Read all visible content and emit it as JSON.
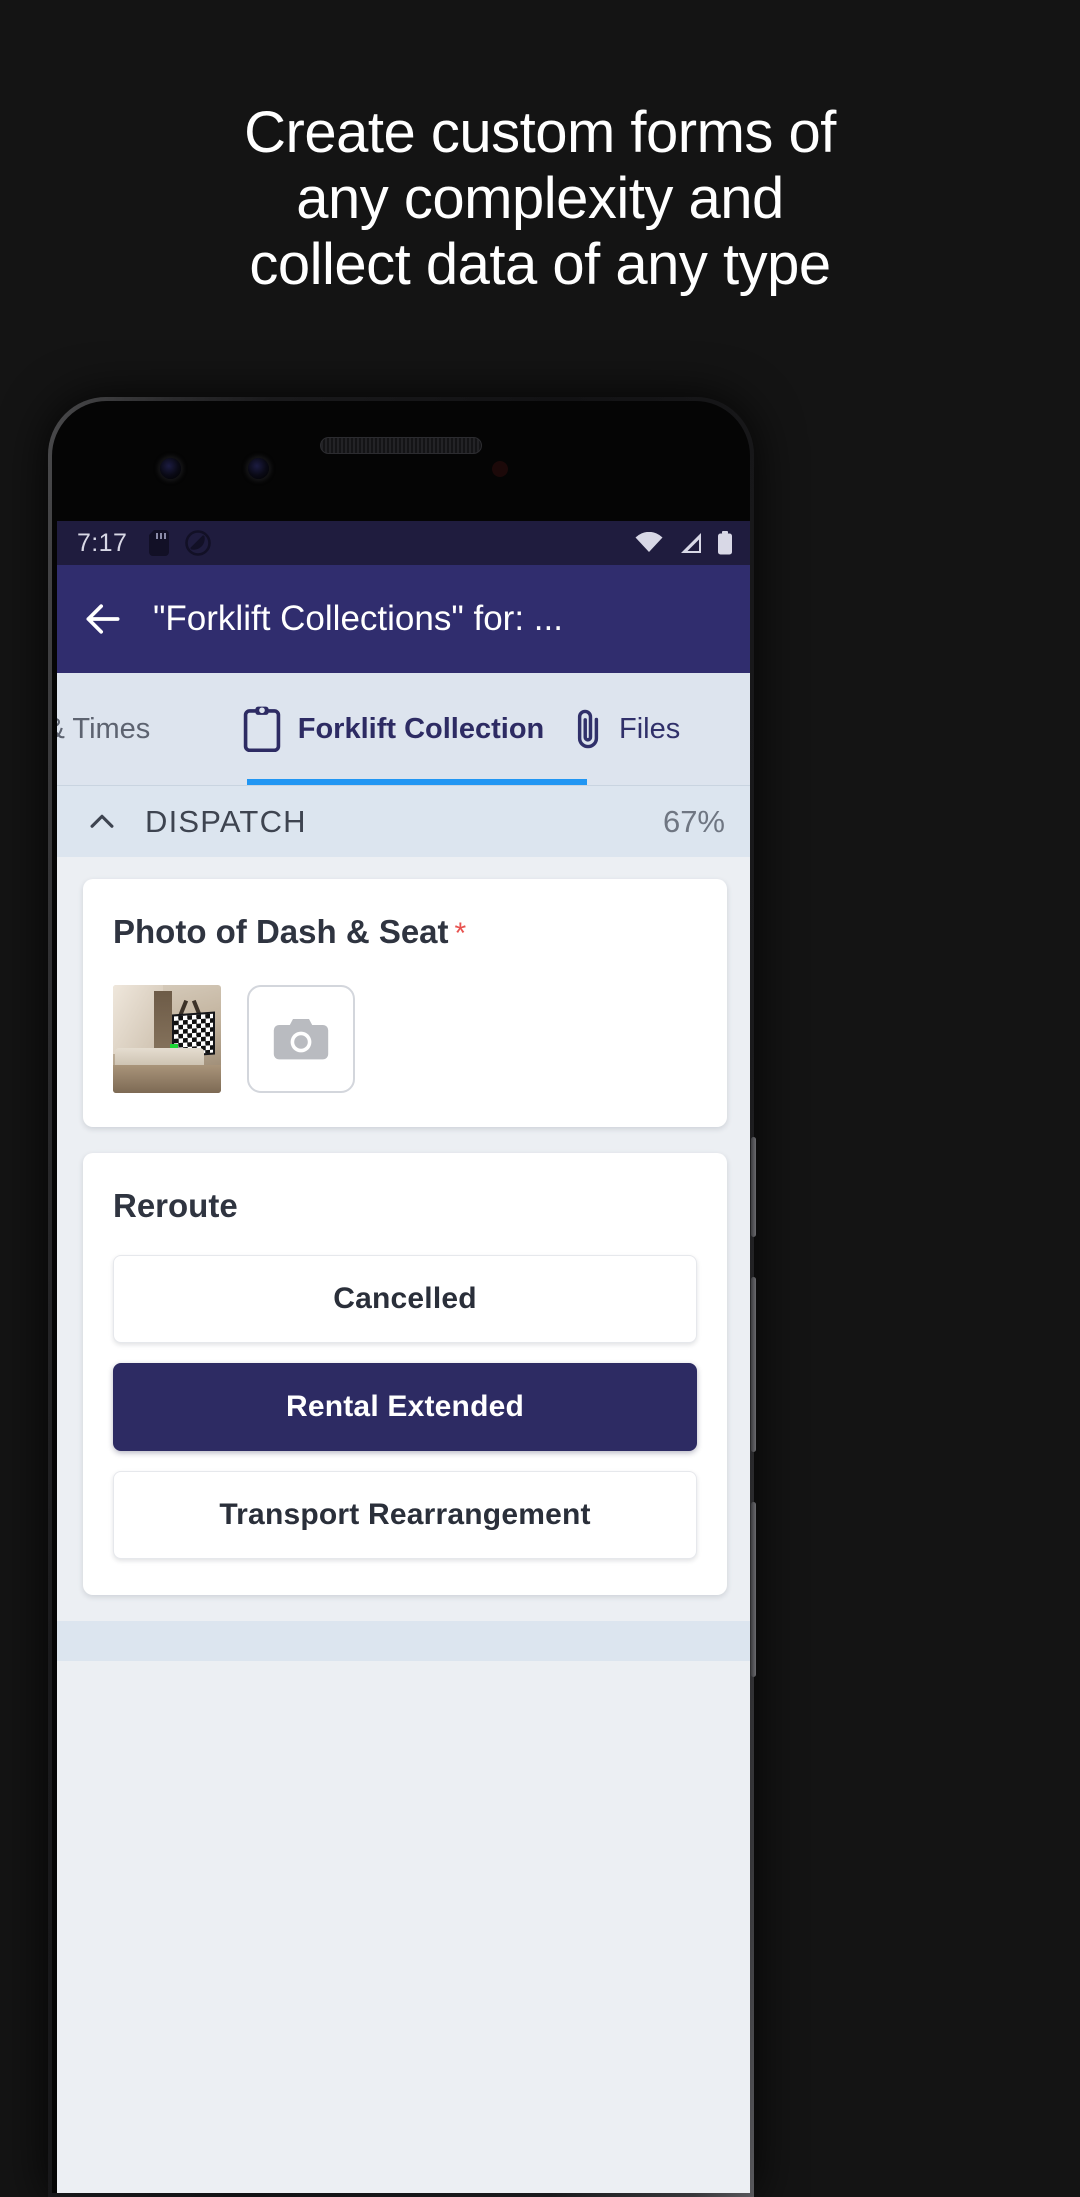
{
  "promo": {
    "headline_lines": [
      "Create custom forms of",
      "any complexity and",
      "collect data of any type"
    ]
  },
  "status_bar": {
    "time": "7:17",
    "left_icons": [
      "sd-card-icon",
      "do-not-disturb-icon"
    ],
    "right_icons": [
      "wifi-icon",
      "cell-signal-icon",
      "battery-icon"
    ],
    "background_color": "#1f1c3e"
  },
  "app_bar": {
    "back_label": "back-arrow",
    "title": "\"Forklift Collections\" for: ...",
    "background_color": "#302d6e"
  },
  "tabs": {
    "background_color": "#dde4ee",
    "active_underline_color": "#2196f3",
    "items": [
      {
        "label": "s & Times",
        "icon": "",
        "active": false
      },
      {
        "label": "Forklift Collection",
        "icon": "clipboard-icon",
        "active": true
      },
      {
        "label": "Files",
        "icon": "paperclip-icon",
        "active": false
      }
    ]
  },
  "section": {
    "title": "DISPATCH",
    "progress": "67%",
    "collapse_icon": "chevron-up-icon",
    "background_color": "#dce5ef"
  },
  "photo_field": {
    "label": "Photo of Dash & Seat",
    "required_marker": "*",
    "required_color": "#e8524f",
    "thumbnail_name": "photo-thumbnail",
    "add_button_icon": "camera-icon"
  },
  "reroute_field": {
    "label": "Reroute",
    "selected_color": "#2d2b63",
    "options": [
      {
        "label": "Cancelled",
        "selected": false
      },
      {
        "label": "Rental Extended",
        "selected": true
      },
      {
        "label": "Transport Rearrangement",
        "selected": false
      }
    ]
  }
}
